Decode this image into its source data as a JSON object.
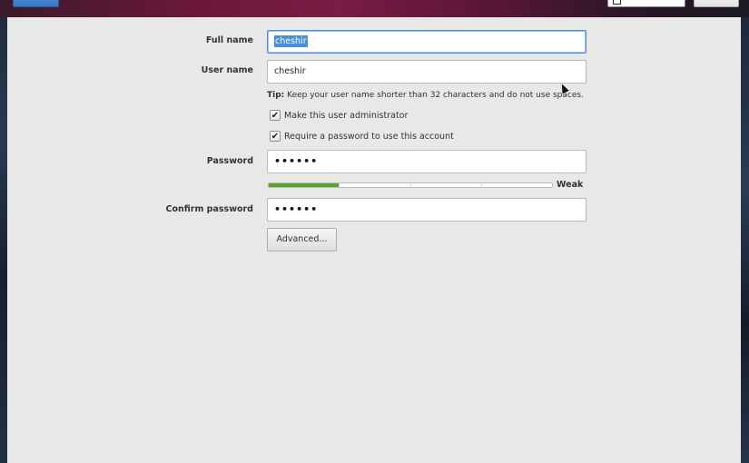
{
  "form": {
    "full_name_label": "Full name",
    "full_name_value": "cheshir",
    "username_label": "User name",
    "username_value": "cheshir",
    "tip_prefix": "Tip:",
    "tip_text": " Keep your user name shorter than 32 characters and do not use spaces.",
    "admin_checkbox_label": "Make this user administrator",
    "admin_checked": true,
    "require_password_label": "Require a password to use this account",
    "require_password_checked": true,
    "password_label": "Password",
    "password_value": "••••••",
    "strength_label": "Weak",
    "strength_level": 0.25,
    "confirm_label": "Confirm password",
    "confirm_value": "••••••",
    "advanced_button": "Advanced..."
  },
  "colors": {
    "accent": "#4a90d9",
    "strength_fill": "#58a32e",
    "panel_bg": "#e8e8e7"
  },
  "icons": {
    "check": "check-icon",
    "keyboard": "keyboard-icon",
    "cursor": "mouse-pointer-icon"
  }
}
